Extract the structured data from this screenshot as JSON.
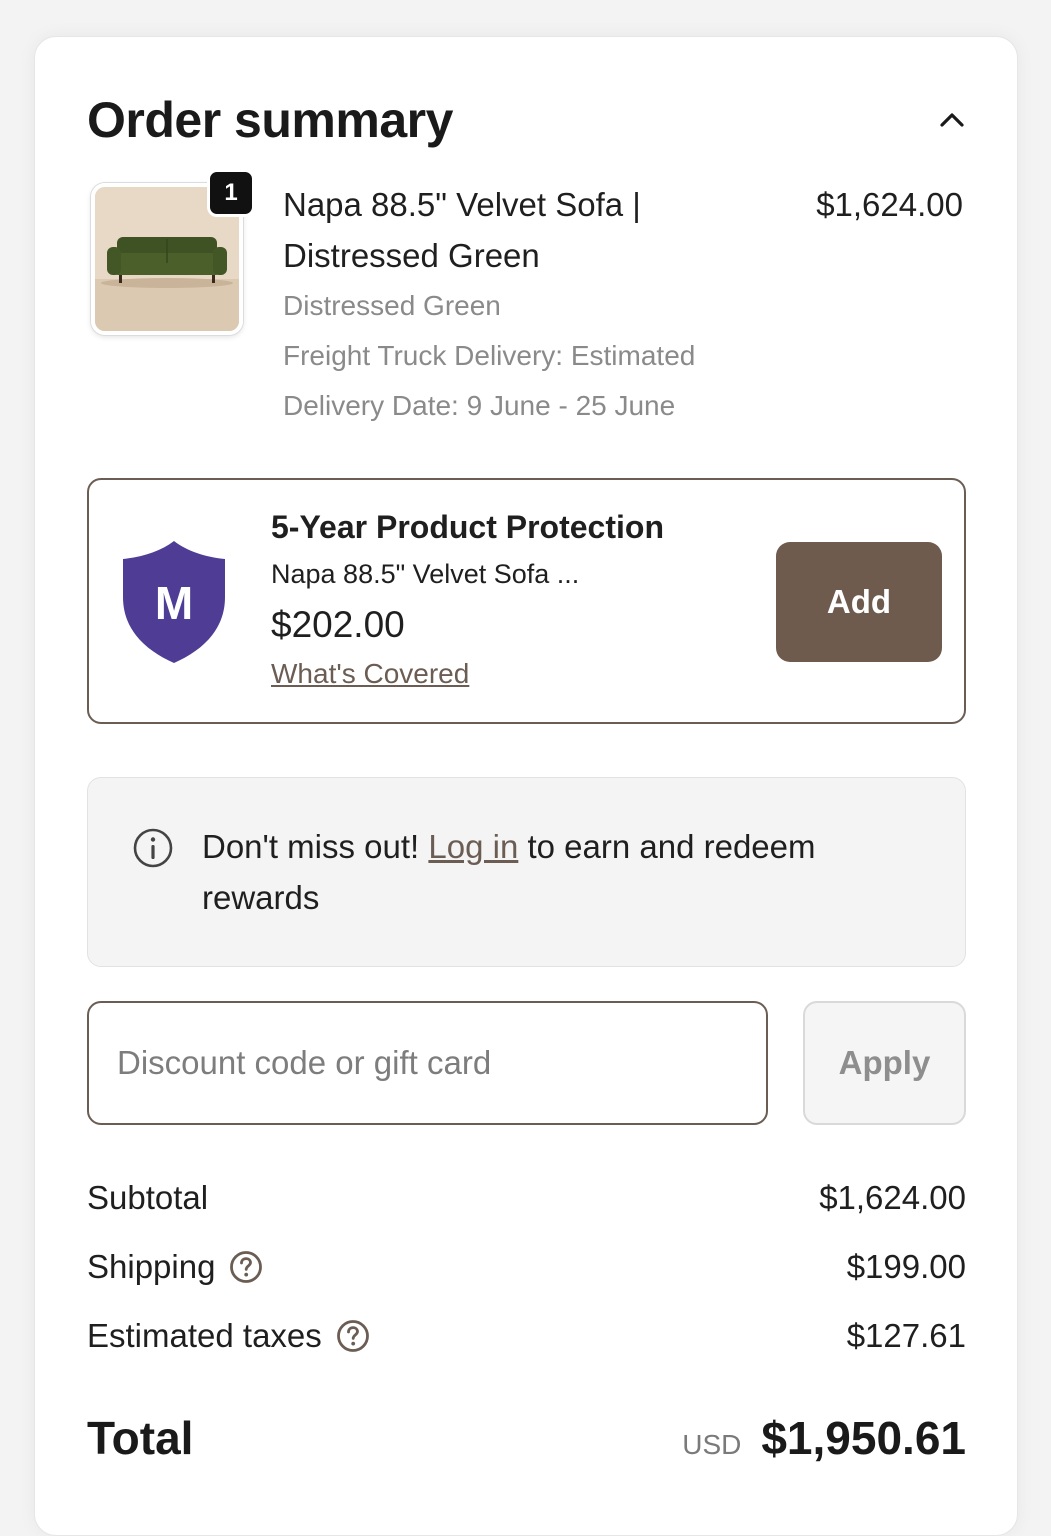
{
  "summary": {
    "title": "Order summary"
  },
  "product": {
    "quantity": "1",
    "name_line1": "Napa 88.5\" Velvet Sofa |",
    "name_line2": "Distressed Green",
    "variant": "Distressed Green",
    "delivery_line1": "Freight Truck Delivery: Estimated",
    "delivery_line2": "Delivery Date: 9 June - 25 June",
    "price": "$1,624.00",
    "image_icon": "green-velvet-sofa-image"
  },
  "protection": {
    "title": "5-Year Product Protection",
    "subtitle": "Napa 88.5\" Velvet Sofa ...",
    "price": "$202.00",
    "link": "What's Covered",
    "add_label": "Add",
    "shield_letter": "M",
    "shield_color": "#4e3c95",
    "button_color": "#6e5b4e"
  },
  "rewards": {
    "prefix": "Don't miss out! ",
    "link": "Log in",
    "suffix": " to earn and redeem rewards"
  },
  "discount": {
    "placeholder": "Discount code or gift card",
    "value": "",
    "apply_label": "Apply"
  },
  "totals": {
    "subtotal_label": "Subtotal",
    "subtotal_value": "$1,624.00",
    "shipping_label": "Shipping",
    "shipping_value": "$199.00",
    "taxes_label": "Estimated taxes",
    "taxes_value": "$127.61",
    "total_label": "Total",
    "currency": "USD",
    "total_value": "$1,950.61"
  }
}
